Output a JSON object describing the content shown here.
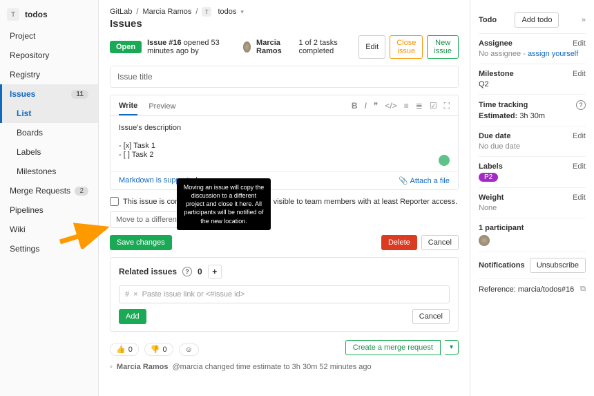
{
  "sidebar": {
    "project_initial": "T",
    "project_name": "todos",
    "items": [
      {
        "label": "Project"
      },
      {
        "label": "Repository"
      },
      {
        "label": "Registry"
      },
      {
        "label": "Issues",
        "badge": "11"
      },
      {
        "label": "Merge Requests",
        "badge": "2"
      },
      {
        "label": "Pipelines"
      },
      {
        "label": "Wiki"
      },
      {
        "label": "Settings"
      }
    ],
    "issues_sub": [
      {
        "label": "List"
      },
      {
        "label": "Boards"
      },
      {
        "label": "Labels"
      },
      {
        "label": "Milestones"
      }
    ]
  },
  "breadcrumb": {
    "a": "GitLab",
    "b": "Marcia Ramos",
    "c_initial": "T",
    "c": "todos"
  },
  "page_title": "Issues",
  "status": {
    "badge": "Open",
    "issue": "Issue #16",
    "meta": "opened 53 minutes ago by",
    "author": "Marcia Ramos",
    "tasks": "1 of 2 tasks completed"
  },
  "buttons": {
    "edit": "Edit",
    "close": "Close issue",
    "new": "New issue",
    "save": "Save changes",
    "delete": "Delete",
    "cancel": "Cancel",
    "add": "Add",
    "mr": "Create a merge request",
    "unsub": "Unsubscribe",
    "add_todo": "Add todo"
  },
  "title_input": "Issue title",
  "tabs": {
    "write": "Write",
    "preview": "Preview"
  },
  "description": "Issue's description\n\n- [x] Task 1\n- [ ] Task 2",
  "md_support": "Markdown is supported",
  "attach": "Attach a file",
  "confidential": "This issue is confidential and should only be visible to team members with at least Reporter access.",
  "move_placeholder": "Move to a different project",
  "tooltip": "Moving an issue will copy the discussion to a different project and close it here. All participants will be notified of the new location.",
  "related": {
    "title": "Related issues",
    "count": "0",
    "placeholder": "Paste issue link or <#issue id>",
    "hash": "#",
    "x": "×"
  },
  "emoji": {
    "up": "0",
    "down": "0"
  },
  "activity": {
    "author": "Marcia Ramos",
    "handle": "@marcia changed time estimate to 3h 30m 52 minutes ago"
  },
  "right": {
    "todo": "Todo",
    "assignee": {
      "label": "Assignee",
      "val": "No assignee - ",
      "action": "assign yourself"
    },
    "milestone": {
      "label": "Milestone",
      "val": "Q2"
    },
    "tracking": {
      "label": "Time tracking",
      "est_label": "Estimated:",
      "est_val": "3h 30m"
    },
    "due": {
      "label": "Due date",
      "val": "No due date"
    },
    "labels": {
      "label": "Labels",
      "val": "P2"
    },
    "weight": {
      "label": "Weight",
      "val": "None"
    },
    "participants": "1 participant",
    "notifications": "Notifications",
    "reference": {
      "label": "Reference:",
      "val": "marcia/todos#16"
    },
    "edit": "Edit"
  }
}
